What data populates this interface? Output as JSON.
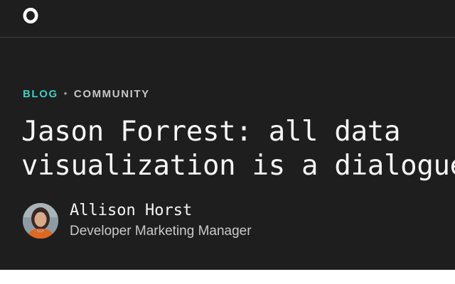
{
  "header": {
    "logo_icon": "observable-logo-icon"
  },
  "post": {
    "category": "BLOG",
    "separator": "•",
    "subcategory": "COMMUNITY",
    "title_line1": "Jason Forrest: all data",
    "title_line2": "visualization is a dialogue"
  },
  "author": {
    "name": "Allison Horst",
    "role": "Developer Marketing Manager",
    "avatar_icon": "author-avatar"
  },
  "colors": {
    "background": "#1e1e1e",
    "accent": "#3ecfc0",
    "text": "#f5f5f5",
    "muted": "#c9c9c9"
  }
}
